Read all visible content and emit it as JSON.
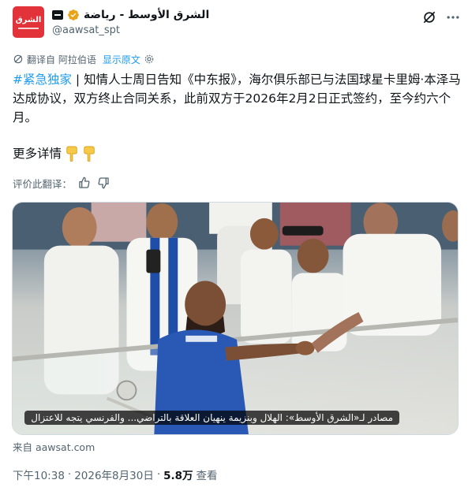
{
  "account": {
    "display_name": "الشرق الأوسط - رياضة",
    "handle": "@aawsat_spt",
    "avatar_text": "الشرق",
    "verified_color": "#e8a317"
  },
  "translation": {
    "label": "翻译自 阿拉伯语",
    "show_original": "显示原文"
  },
  "tweet": {
    "hashtag": "#紧急独家",
    "body": " | 知情人士周日告知《中东报》，海尔俱乐部已与法国球星卡里姆·本泽马达成协议，双方终止合同关系，此前双方于2026年2月2日正式签约，至今约六个月。",
    "more": "更多详情",
    "emoji": [
      "pointing-down-hand-icon",
      "pointing-down-hand-icon"
    ]
  },
  "rate": {
    "label": "评价此翻译："
  },
  "media": {
    "caption": "مصادر لـ«الشرق الأوسط»: الهلال وبنزيمة ينهيان العلاقة بالتراضي... والفرنسي يتجه للاعتزال"
  },
  "source": "来自 aawsat.com",
  "meta": {
    "time": "下午10:38",
    "date": "2026年8月30日",
    "views_count": "5.8万",
    "views_label": "查看",
    "separator": "·"
  },
  "colors": {
    "accent": "#1d9bf0",
    "text": "#0f1419",
    "muted": "#536471",
    "brand": "#e2333a"
  }
}
